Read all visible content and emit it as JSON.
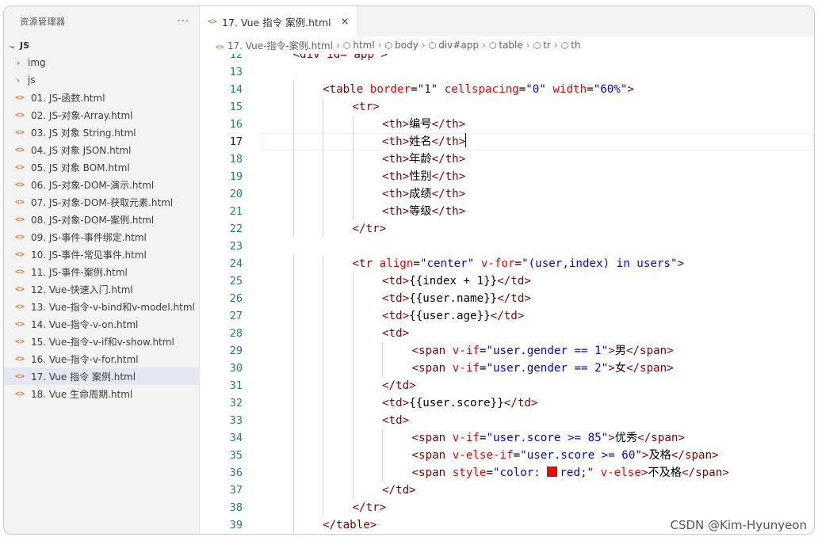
{
  "sidebar": {
    "title": "资源管理器",
    "more": "···",
    "section": "JS",
    "folders": [
      "img",
      "js"
    ],
    "files": [
      "01. JS-函数.html",
      "02. JS-对象-Array.html",
      "03. JS 对象 String.html",
      "04. JS 对象 JSON.html",
      "05. JS 对象 BOM.html",
      "06. JS-对象-DOM-演示.html",
      "07. JS-对象-DOM-获取元素.html",
      "08. JS-对象-DOM-案例.html",
      "09. JS-事件-事件绑定.html",
      "10. JS-事件-常见事件.html",
      "11. JS-事件-案例.html",
      "12. Vue-快速入门.html",
      "13. Vue-指令-v-bind和v-model.html",
      "14. Vue-指令-v-on.html",
      "15. Vue-指令-v-if和v-show.html",
      "16. Vue-指令-v-for.html",
      "17. Vue 指令 案例.html",
      "18. Vue 生命周期.html"
    ],
    "active_index": 16
  },
  "tab": {
    "icon": "<>",
    "label": "17. Vue 指令 案例.html",
    "close": "×"
  },
  "breadcrumb": {
    "file": "17. Vue-指令-案例.html",
    "items": [
      "html",
      "body",
      "div#app",
      "table",
      "tr",
      "th"
    ]
  },
  "editor": {
    "first_line": 12,
    "current_line": 17,
    "lines": [
      [
        [
          "tag",
          "<div id=\"app\">"
        ]
      ],
      [],
      [
        [
          "tag",
          "<table "
        ],
        [
          "attr",
          "border"
        ],
        [
          "txt",
          "="
        ],
        [
          "str",
          "\"1\""
        ],
        [
          "attr",
          " cellspacing"
        ],
        [
          "txt",
          "="
        ],
        [
          "str",
          "\"0\""
        ],
        [
          "attr",
          " width"
        ],
        [
          "txt",
          "="
        ],
        [
          "str",
          "\"60%\""
        ],
        [
          "tag",
          ">"
        ]
      ],
      [
        [
          "tag",
          "<tr>"
        ]
      ],
      [
        [
          "tag",
          "<th>"
        ],
        [
          "txt",
          "编号"
        ],
        [
          "tag",
          "</th>"
        ]
      ],
      [
        [
          "tag",
          "<th>"
        ],
        [
          "txt",
          "姓名"
        ],
        [
          "tag",
          "</th>"
        ],
        [
          "caret",
          ""
        ]
      ],
      [
        [
          "tag",
          "<th>"
        ],
        [
          "txt",
          "年龄"
        ],
        [
          "tag",
          "</th>"
        ]
      ],
      [
        [
          "tag",
          "<th>"
        ],
        [
          "txt",
          "性别"
        ],
        [
          "tag",
          "</th>"
        ]
      ],
      [
        [
          "tag",
          "<th>"
        ],
        [
          "txt",
          "成绩"
        ],
        [
          "tag",
          "</th>"
        ]
      ],
      [
        [
          "tag",
          "<th>"
        ],
        [
          "txt",
          "等级"
        ],
        [
          "tag",
          "</th>"
        ]
      ],
      [
        [
          "tag",
          "</tr>"
        ]
      ],
      [],
      [
        [
          "tag",
          "<tr "
        ],
        [
          "attr",
          "align"
        ],
        [
          "txt",
          "="
        ],
        [
          "str",
          "\"center\""
        ],
        [
          "attr",
          " v-for"
        ],
        [
          "txt",
          "="
        ],
        [
          "str",
          "\"(user,index) in users\""
        ],
        [
          "tag",
          ">"
        ]
      ],
      [
        [
          "tag",
          "<td>"
        ],
        [
          "txt",
          "{{index + 1}}"
        ],
        [
          "tag",
          "</td>"
        ]
      ],
      [
        [
          "tag",
          "<td>"
        ],
        [
          "txt",
          "{{user.name}}"
        ],
        [
          "tag",
          "</td>"
        ]
      ],
      [
        [
          "tag",
          "<td>"
        ],
        [
          "txt",
          "{{user.age}}"
        ],
        [
          "tag",
          "</td>"
        ]
      ],
      [
        [
          "tag",
          "<td>"
        ]
      ],
      [
        [
          "tag",
          "<span "
        ],
        [
          "attr",
          "v-if"
        ],
        [
          "txt",
          "="
        ],
        [
          "str",
          "\"user.gender == 1\""
        ],
        [
          "tag",
          ">"
        ],
        [
          "txt",
          "男"
        ],
        [
          "tag",
          "</span>"
        ]
      ],
      [
        [
          "tag",
          "<span "
        ],
        [
          "attr",
          "v-if"
        ],
        [
          "txt",
          "="
        ],
        [
          "str",
          "\"user.gender == 2\""
        ],
        [
          "tag",
          ">"
        ],
        [
          "txt",
          "女"
        ],
        [
          "tag",
          "</span>"
        ]
      ],
      [
        [
          "tag",
          "</td>"
        ]
      ],
      [
        [
          "tag",
          "<td>"
        ],
        [
          "txt",
          "{{user.score}}"
        ],
        [
          "tag",
          "</td>"
        ]
      ],
      [
        [
          "tag",
          "<td>"
        ]
      ],
      [
        [
          "tag",
          "<span "
        ],
        [
          "attr",
          "v-if"
        ],
        [
          "txt",
          "="
        ],
        [
          "str",
          "\"user.score >= 85\""
        ],
        [
          "tag",
          ">"
        ],
        [
          "txt",
          "优秀"
        ],
        [
          "tag",
          "</span>"
        ]
      ],
      [
        [
          "tag",
          "<span "
        ],
        [
          "attr",
          "v-else-if"
        ],
        [
          "txt",
          "="
        ],
        [
          "str",
          "\"user.score >= 60\""
        ],
        [
          "tag",
          ">"
        ],
        [
          "txt",
          "及格"
        ],
        [
          "tag",
          "</span>"
        ]
      ],
      [
        [
          "tag",
          "<span "
        ],
        [
          "attr",
          "style"
        ],
        [
          "txt",
          "="
        ],
        [
          "str",
          "\"color: "
        ],
        [
          "swatch",
          ""
        ],
        [
          "str",
          "red;\""
        ],
        [
          "attr",
          " v-else"
        ],
        [
          "tag",
          ">"
        ],
        [
          "txt",
          "不及格"
        ],
        [
          "tag",
          "</span>"
        ]
      ],
      [
        [
          "tag",
          "</td>"
        ]
      ],
      [
        [
          "tag",
          "</tr>"
        ]
      ],
      [
        [
          "tag",
          "</table>"
        ]
      ]
    ],
    "indents": [
      1,
      0,
      2,
      3,
      4,
      4,
      4,
      4,
      4,
      4,
      3,
      0,
      3,
      4,
      4,
      4,
      4,
      5,
      5,
      4,
      4,
      4,
      5,
      5,
      5,
      4,
      3,
      2
    ]
  },
  "watermark": "CSDN @Kim-Hyunyeon"
}
